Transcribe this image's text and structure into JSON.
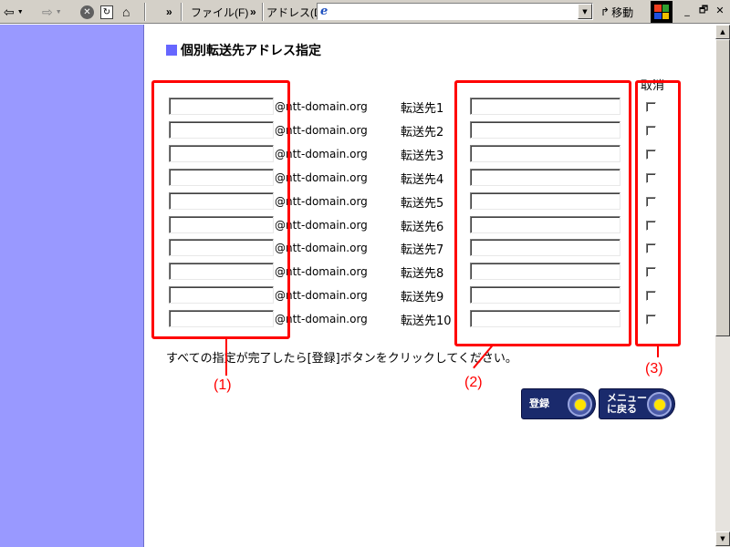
{
  "toolbar": {
    "back_icon": "back-arrow-icon",
    "forward_icon": "forward-arrow-icon",
    "chevron": "»",
    "file_menu": "ファイル(F)",
    "address_label": "アドレス(D)",
    "address_value": "",
    "go_label": "移動",
    "window_controls": [
      "_",
      "🗗",
      "✕"
    ]
  },
  "page": {
    "title": "個別転送先アドレス指定",
    "cancel_header": "取消",
    "domain_suffix": "@ntt-domain.org",
    "rows": [
      {
        "local": "",
        "dest_label": "転送先1",
        "dest": "",
        "cancel": false
      },
      {
        "local": "",
        "dest_label": "転送先2",
        "dest": "",
        "cancel": false
      },
      {
        "local": "",
        "dest_label": "転送先3",
        "dest": "",
        "cancel": false
      },
      {
        "local": "",
        "dest_label": "転送先4",
        "dest": "",
        "cancel": false
      },
      {
        "local": "",
        "dest_label": "転送先5",
        "dest": "",
        "cancel": false
      },
      {
        "local": "",
        "dest_label": "転送先6",
        "dest": "",
        "cancel": false
      },
      {
        "local": "",
        "dest_label": "転送先7",
        "dest": "",
        "cancel": false
      },
      {
        "local": "",
        "dest_label": "転送先8",
        "dest": "",
        "cancel": false
      },
      {
        "local": "",
        "dest_label": "転送先9",
        "dest": "",
        "cancel": false
      },
      {
        "local": "",
        "dest_label": "転送先10",
        "dest": "",
        "cancel": false
      }
    ],
    "instruction": "すべての指定が完了したら[登録]ボタンをクリックしてください。",
    "register_button": "登録",
    "menu_button": "メニュー\nに戻る"
  },
  "annotations": {
    "label1": "(1)",
    "label2": "(2)",
    "label3": "(3)",
    "color": "#ff0000"
  }
}
